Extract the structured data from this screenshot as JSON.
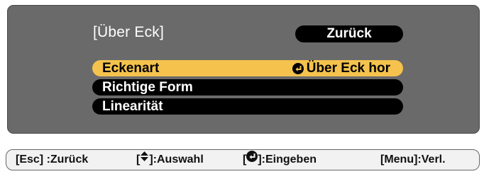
{
  "dialog": {
    "title": "[Über Eck]",
    "back_label": "Zurück",
    "items": [
      {
        "label": "Eckenart",
        "value": "Über Eck hor",
        "selected": true
      },
      {
        "label": "Richtige Form",
        "value": ""
      },
      {
        "label": "Linearität",
        "value": ""
      }
    ]
  },
  "help": {
    "esc": "[Esc] :Zurück",
    "select_prefix": "[",
    "select_suffix": "]:Auswahl",
    "enter_prefix": "[",
    "enter_suffix": "]:Eingeben",
    "menu": "[Menu]:Verl."
  },
  "colors": {
    "panel": "#6a6a6a",
    "highlight": "#f5c34d",
    "item_bg": "#000000"
  },
  "icons": {
    "enter": "enter-icon",
    "updown": "up-down-arrow-icon"
  }
}
